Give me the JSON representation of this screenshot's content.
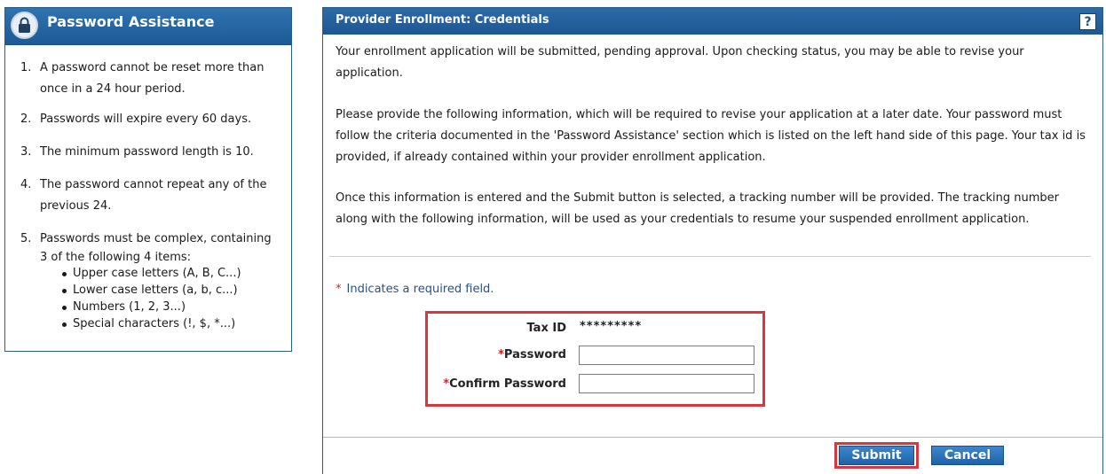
{
  "password_assistance": {
    "title": "Password Assistance",
    "icon": "lock-icon",
    "items": [
      {
        "num": "1.",
        "text": "A password cannot be reset more than once in a 24 hour period."
      },
      {
        "num": "2.",
        "text": "Passwords will expire every 60 days."
      },
      {
        "num": "3.",
        "text": "The minimum password length is 10."
      },
      {
        "num": "4.",
        "text": "The password cannot repeat any of the previous 24."
      },
      {
        "num": "5.",
        "text": "Passwords must be complex, containing 3 of the following 4 items:"
      }
    ],
    "sub_items": [
      "Upper case letters (A, B, C...)",
      "Lower case letters (a, b, c...)",
      "Numbers (1, 2, 3...)",
      "Special characters (!, $, *...)"
    ]
  },
  "provider_enrollment": {
    "title": "Provider Enrollment: Credentials",
    "help_label": "?",
    "paragraphs": [
      "Your enrollment application will be submitted, pending approval. Upon checking status, you may be able to revise your application.",
      "Please provide the following information, which will be required to revise your application at a later date. Your password must follow the criteria documented in the 'Password Assistance' section which is listed on the left hand side of this page. Your tax id is provided, if already contained within your provider enrollment application.",
      "Once this information is entered and the Submit button is selected, a tracking number will be provided. The tracking number along with the following information, will be used as your credentials to resume your suspended enrollment application."
    ],
    "required_note": {
      "star": "*",
      "text": "Indicates a required field."
    },
    "form": {
      "tax_id_label": "Tax ID",
      "tax_id_value": "*********",
      "password_label": "Password",
      "password_value": "",
      "confirm_label": "Confirm Password",
      "confirm_value": "",
      "required_star": "*"
    },
    "buttons": {
      "submit": "Submit",
      "cancel": "Cancel"
    }
  },
  "colors": {
    "header_blue": "#1e5791",
    "highlight_red": "#d9363e",
    "required_red": "#d71f26",
    "link_blue": "#2a4f86"
  }
}
